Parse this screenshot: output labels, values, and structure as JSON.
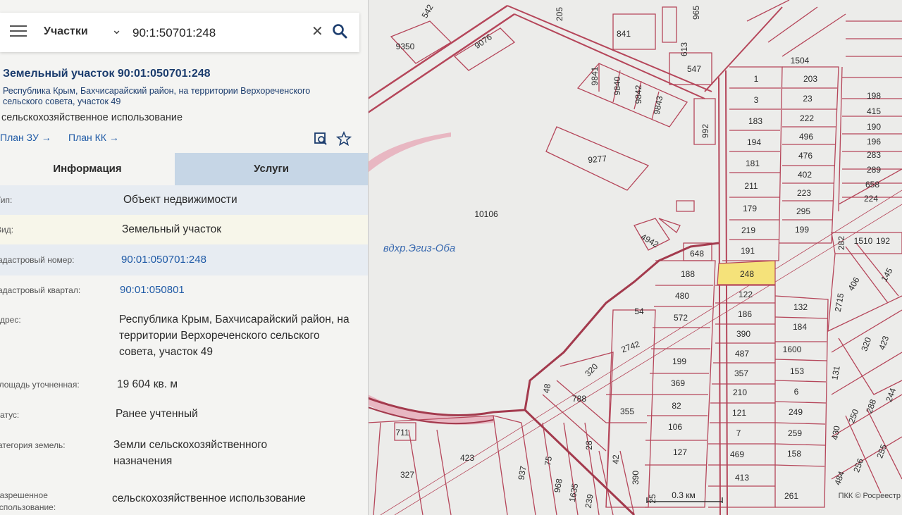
{
  "search": {
    "category": "Участки",
    "query": "90:1:50701:248"
  },
  "header": {
    "title": "Земельный участок 90:01:050701:248",
    "address": "Республика Крым, Бахчисарайский район, на территории Верхореченского сельского совета, участок 49",
    "use": "сельскохозяйственное использование",
    "link_plan_zu": "План ЗУ →",
    "link_plan_kk": "План КК →"
  },
  "tabs": {
    "info": "Информация",
    "services": "Услуги"
  },
  "rows": {
    "type": {
      "label": "Тип:",
      "value": "Объект недвижимости"
    },
    "kind": {
      "label": "Вид:",
      "value": "Земельный участок"
    },
    "cad_num": {
      "label": "Кадастровый номер:",
      "value": "90:01:050701:248"
    },
    "cad_quarter": {
      "label": "Кадастровый квартал:",
      "value": "90:01:050801"
    },
    "address": {
      "label": "Адрес:",
      "value": "Республика Крым, Бахчисарайский район, на территории Верхореченского сельского совета, участок 49"
    },
    "area": {
      "label": "Площадь уточненная:",
      "value": "19 604 кв. м"
    },
    "status": {
      "label": "Статус:",
      "value": "Ранее учтенный"
    },
    "category": {
      "label": "Категория земель:",
      "value": "Земли сельскохозяйственного назначения"
    },
    "permitted": {
      "label": "Разрешенное использование:",
      "value": "сельскохозяйственное использование"
    }
  },
  "map": {
    "water_label": "вдхр.Эгиз-Оба",
    "highlight_color": "#f5e27a",
    "line_color": "#b5465a",
    "scale_label": "0.3 км",
    "attribution": "ПКК © Росреестр",
    "parcels": [
      "9350",
      "9076",
      "205",
      "841",
      "613",
      "547",
      "1504",
      "203",
      "9841",
      "9840",
      "9842",
      "9843",
      "1",
      "3",
      "183",
      "194",
      "181",
      "211",
      "179",
      "219",
      "191",
      "248",
      "122",
      "186",
      "390",
      "487",
      "357",
      "210",
      "121",
      "7",
      "469",
      "413",
      "261",
      "23",
      "222",
      "496",
      "476",
      "402",
      "223",
      "295",
      "199",
      "198",
      "415",
      "190",
      "196",
      "283",
      "289",
      "658",
      "224",
      "992",
      "9277",
      "10106",
      "4942",
      "648",
      "188",
      "480",
      "572",
      "199",
      "369",
      "82",
      "106",
      "127",
      "54",
      "2742",
      "320",
      "48",
      "788",
      "355",
      "28",
      "42",
      "390",
      "711",
      "327",
      "423",
      "937",
      "75",
      "968",
      "1635",
      "239",
      "25",
      "132",
      "184",
      "1600",
      "153",
      "6",
      "249",
      "259",
      "158",
      "282",
      "1510",
      "192",
      "145",
      "406",
      "2715",
      "423",
      "320",
      "131",
      "430",
      "250",
      "288",
      "244",
      "484",
      "256",
      "255",
      "542",
      "965"
    ]
  }
}
